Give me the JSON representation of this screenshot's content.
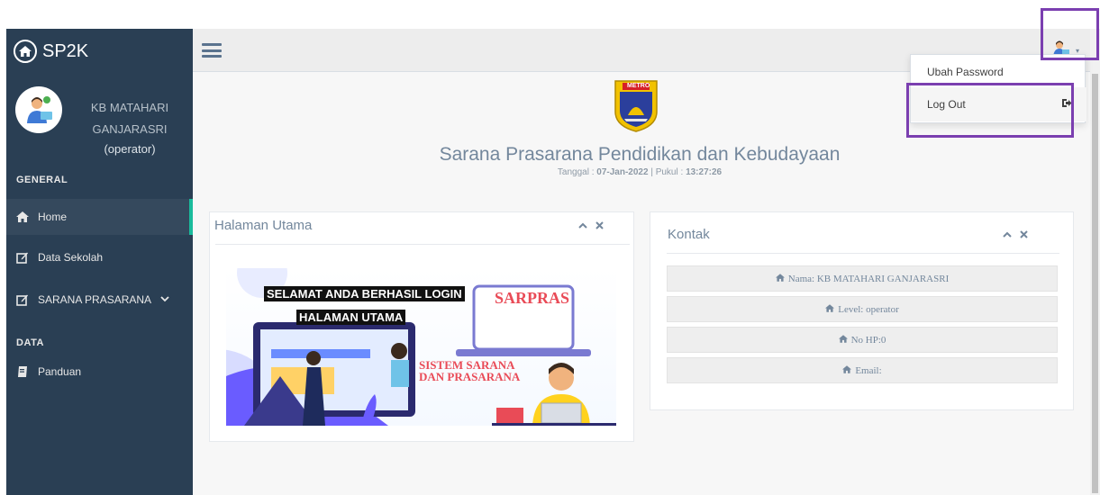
{
  "brand": {
    "name": "SP2K"
  },
  "profile": {
    "name_line1": "KB MATAHARI",
    "name_line2": "GANJARASRI",
    "role": "(operator)"
  },
  "sidebar": {
    "section_general": "GENERAL",
    "section_data": "DATA",
    "items": [
      {
        "label": "Home",
        "icon": "home-icon"
      },
      {
        "label": "Data Sekolah",
        "icon": "edit-icon"
      },
      {
        "label": "SARANA PRASARANA",
        "icon": "edit-icon"
      },
      {
        "label": "Panduan",
        "icon": "book-icon"
      }
    ]
  },
  "header": {
    "title": "Sarana Prasarana Pendidikan dan Kebudayaan",
    "date_label": "Tanggal : ",
    "date": "07-Jan-2022",
    "time_label": " | Pukul : ",
    "time": "13:27:26"
  },
  "emblem": {
    "text": "METRO"
  },
  "panels": {
    "main": {
      "title": "Halaman Utama"
    },
    "contact": {
      "title": "Kontak",
      "rows": [
        "Nama: KB MATAHARI GANJARASRI",
        "Level: operator",
        "No HP:0",
        "Email:"
      ]
    }
  },
  "banner": {
    "line1": "SELAMAT ANDA BERHASIL LOGIN",
    "line2": "HALAMAN UTAMA",
    "sarpras": "SARPRAS",
    "system_line1": "SISTEM SARANA",
    "system_line2": "DAN PRASARANA"
  },
  "user_menu": {
    "items": [
      "Ubah Password",
      "Log Out"
    ]
  },
  "colors": {
    "sidebar": "#2a3f54",
    "accent": "#1abb9c",
    "highlight": "#7b3fb0"
  }
}
